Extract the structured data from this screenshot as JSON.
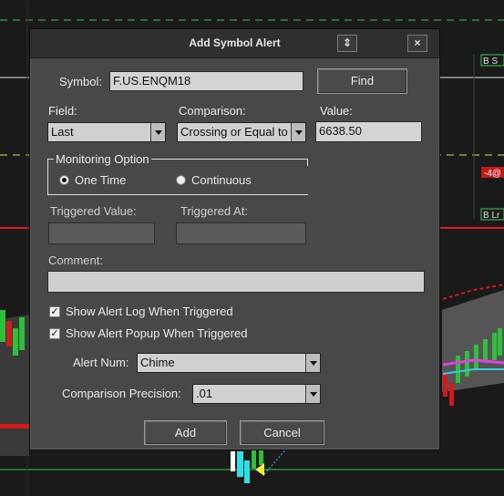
{
  "dialog": {
    "title": "Add Symbol Alert",
    "sort_icon": "⇕",
    "close_icon": "×"
  },
  "symbol": {
    "label": "Symbol:",
    "value": "F.US.ENQM18",
    "find_label": "Find"
  },
  "field": {
    "label": "Field:",
    "value": "Last"
  },
  "comparison": {
    "label": "Comparison:",
    "value": "Crossing or Equal to"
  },
  "value": {
    "label": "Value:",
    "value": "6638.50"
  },
  "monitoring": {
    "label": "Monitoring Option",
    "one_time": "One Time",
    "continuous": "Continuous",
    "selected": "one_time"
  },
  "triggered": {
    "value_label": "Triggered Value:",
    "at_label": "Triggered At:",
    "value": "",
    "at": ""
  },
  "comment": {
    "label": "Comment:",
    "value": ""
  },
  "options": {
    "show_log": "Show Alert Log When Triggered",
    "show_log_checked": true,
    "show_popup": "Show Alert Popup When Triggered",
    "show_popup_checked": true
  },
  "alert_num": {
    "label": "Alert Num:",
    "value": "Chime"
  },
  "precision": {
    "label": "Comparison Precision:",
    "value": ".01"
  },
  "buttons": {
    "add": "Add",
    "cancel": "Cancel"
  },
  "chart_labels": {
    "b_s": "B S",
    "neg_4": "-4@",
    "b_lr": "B Lr"
  },
  "colors": {
    "dialog_bg": "#484848",
    "titlebar": "#2f2f2f",
    "chart_bg": "#1b1b1b"
  }
}
